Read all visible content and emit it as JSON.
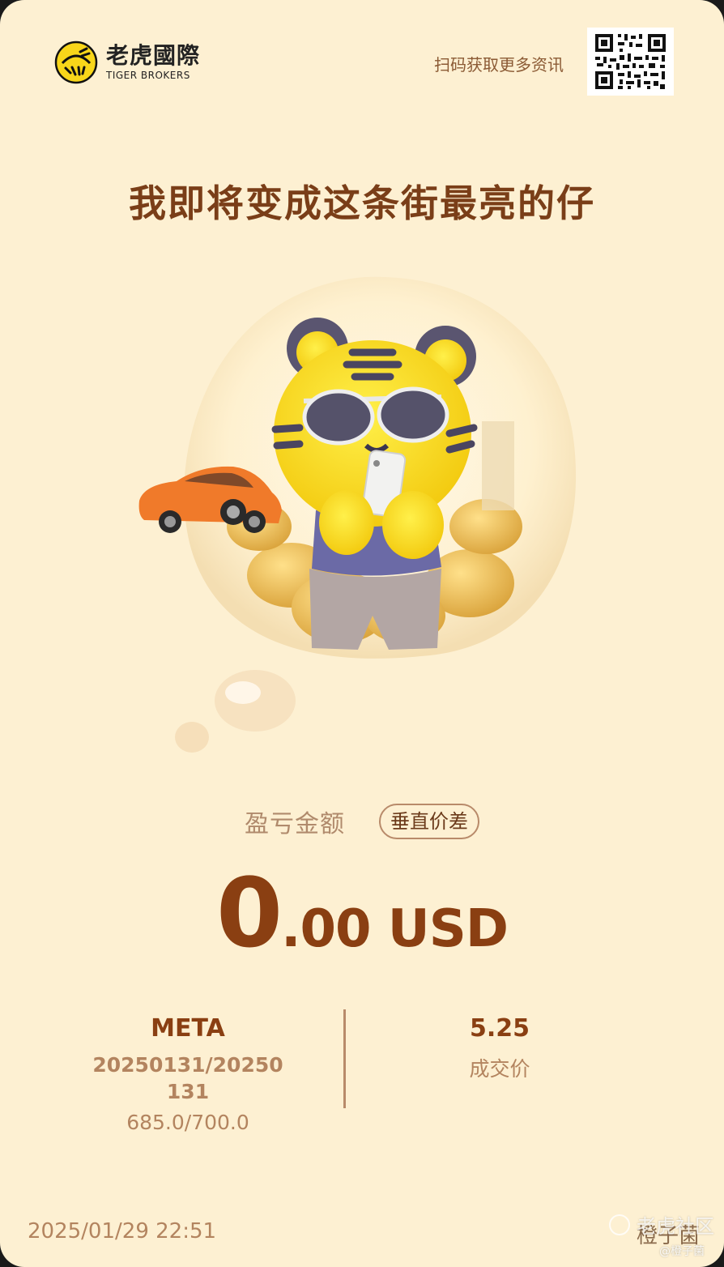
{
  "brand": {
    "name_cn": "老虎國際",
    "name_en": "TIGER BROKERS"
  },
  "header": {
    "scan_text": "扫码获取更多资讯"
  },
  "headline": "我即将变成这条街最亮的仔",
  "pnl": {
    "label": "盈亏金额",
    "chip_label": "垂直价差",
    "amount_int": "0",
    "amount_rest": ".00 USD"
  },
  "trade": {
    "symbol": "META",
    "dates": "20250131/20250131",
    "strikes": "685.0/700.0",
    "price": "5.25",
    "price_label": "成交价"
  },
  "footer": {
    "timestamp": "2025/01/29 22:51",
    "username": "橙子菌"
  },
  "watermark": {
    "community": "老虎社区",
    "handle": "@橙子菌"
  },
  "colors": {
    "background": "#fdf0d2",
    "accent_brown": "#8a3f12",
    "muted_brown": "#b3845f",
    "tiger_yellow": "#f8d61a",
    "car_orange": "#f07a2a"
  },
  "icons": {
    "logo": "tiger-logo-icon",
    "qr": "qr-code-icon",
    "watermark": "community-icon"
  }
}
